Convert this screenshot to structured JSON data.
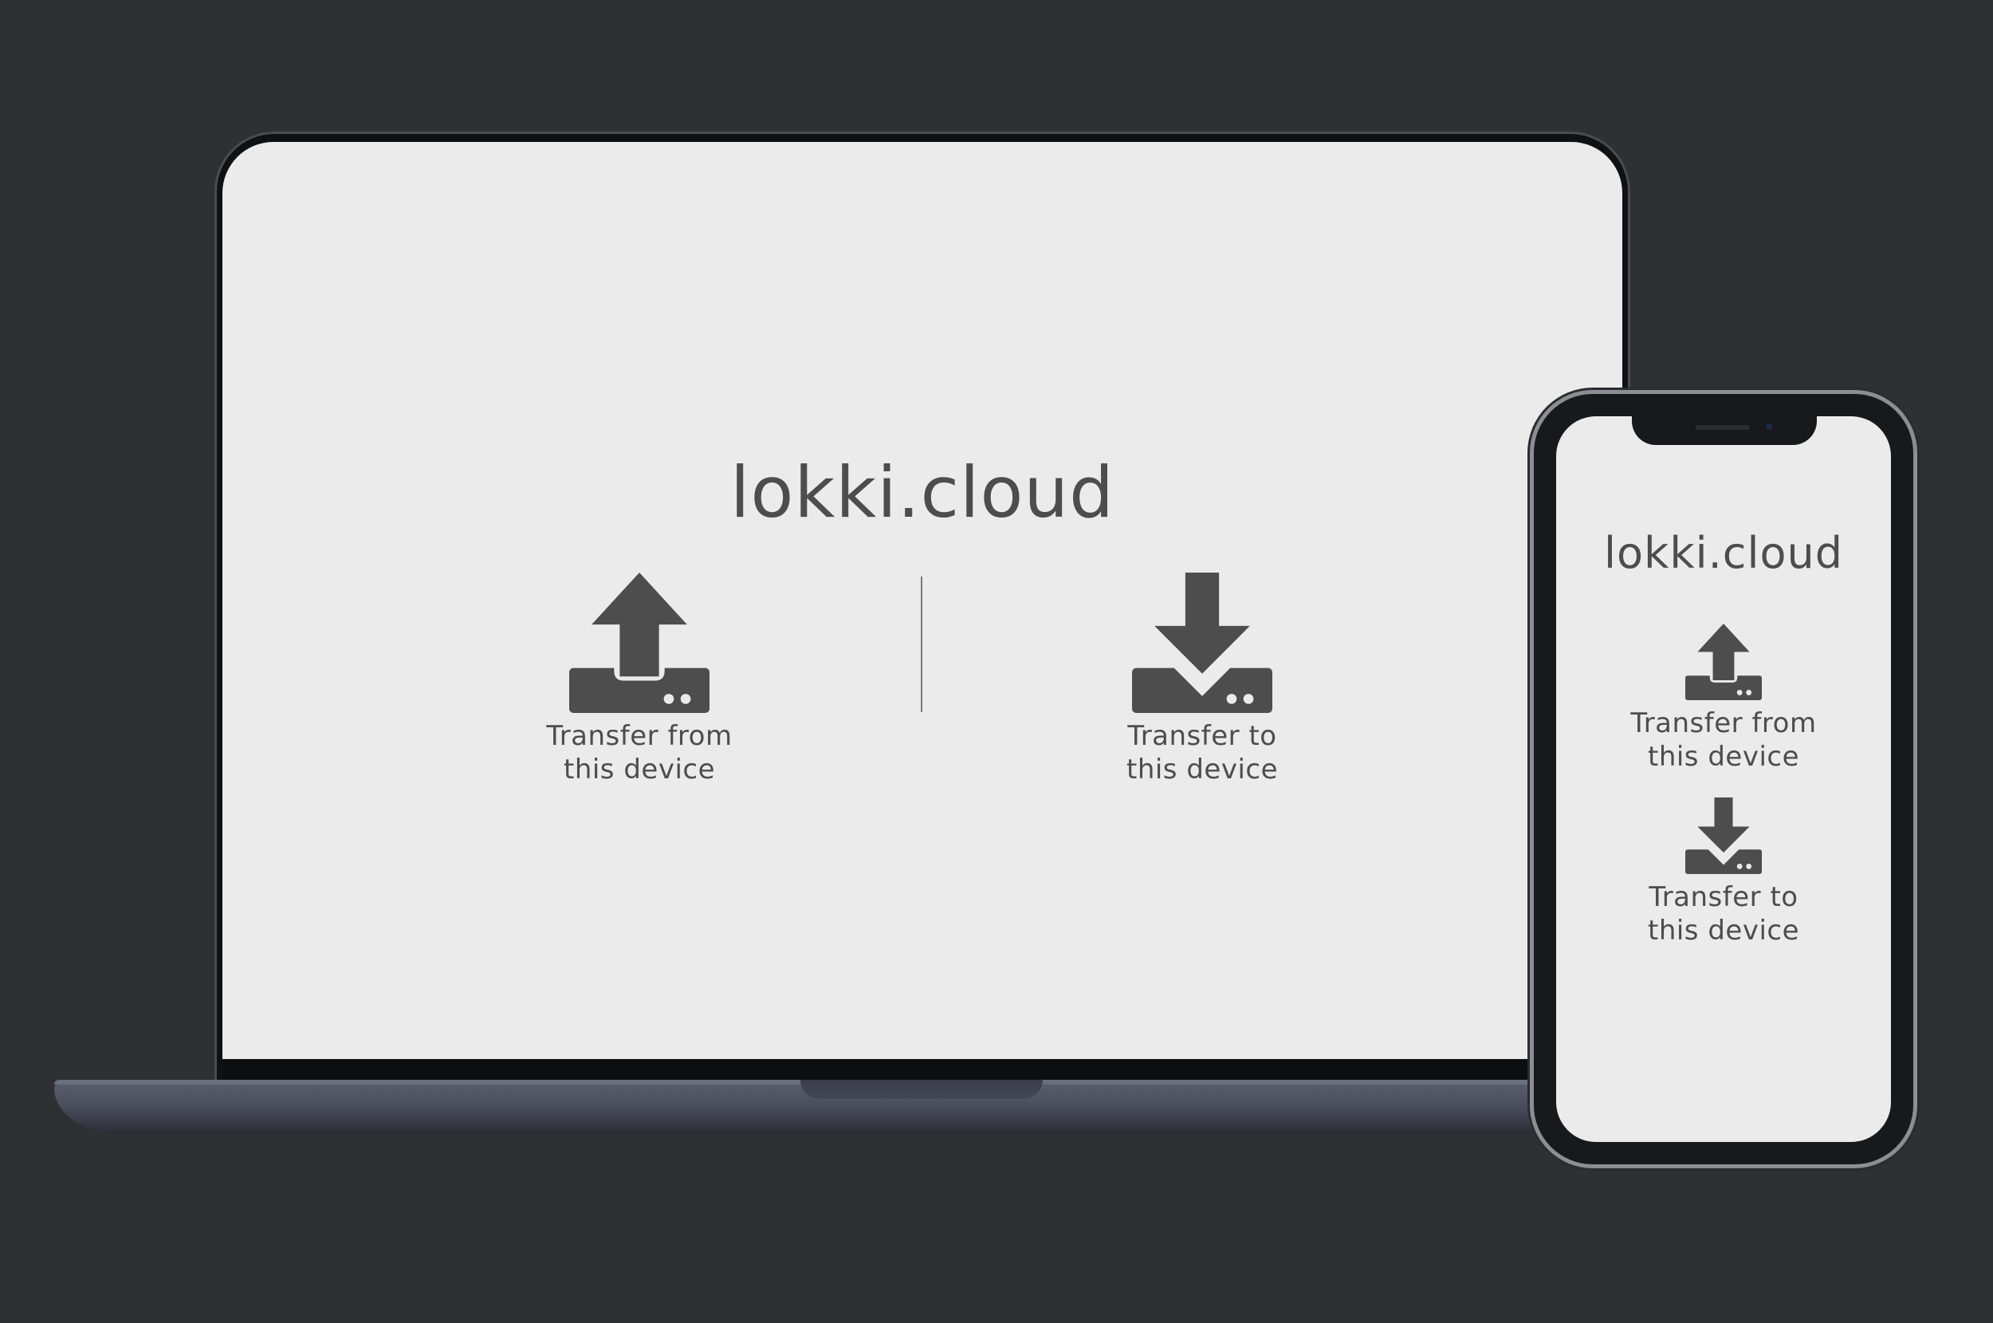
{
  "colors": {
    "background": "#2f3034",
    "screen": "#ebebeb",
    "icon": "#4d4d4d",
    "text": "#4d4d4d"
  },
  "laptop": {
    "title": "lokki.cloud",
    "transfer_from": {
      "label": "Transfer from\nthis device",
      "icon": "upload-tray-icon"
    },
    "transfer_to": {
      "label": "Transfer to\nthis device",
      "icon": "download-tray-icon"
    }
  },
  "phone": {
    "title": "lokki.cloud",
    "transfer_from": {
      "label": "Transfer from\nthis device",
      "icon": "upload-tray-icon"
    },
    "transfer_to": {
      "label": "Transfer to\nthis device",
      "icon": "download-tray-icon"
    }
  }
}
